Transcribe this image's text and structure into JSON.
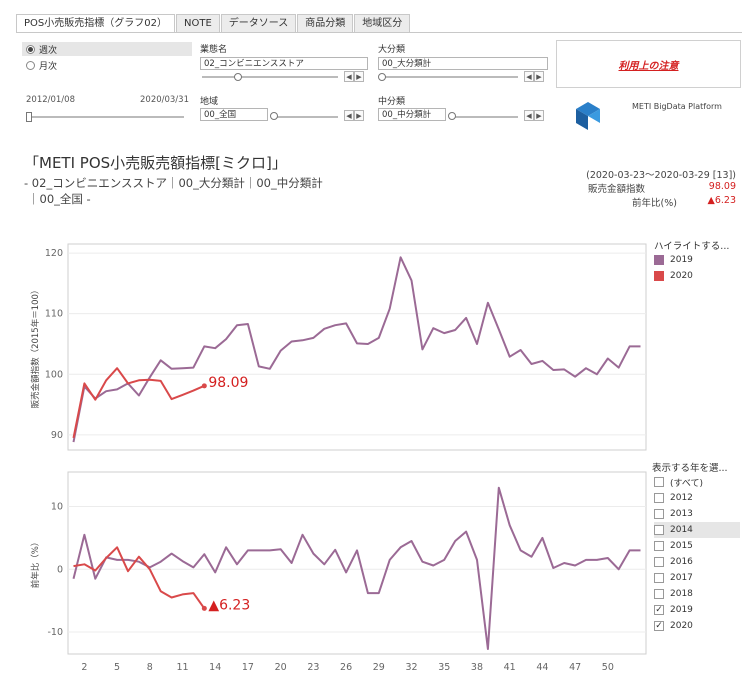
{
  "tabs": [
    "POS小売販売指標（グラフ02）",
    "NOTE",
    "データソース",
    "商品分類",
    "地域区分"
  ],
  "period": {
    "options": [
      "週次",
      "月次"
    ],
    "selected": "週次"
  },
  "date_range": {
    "start": "2012/01/08",
    "end": "2020/03/31"
  },
  "filters": {
    "gyotai": {
      "label": "業態名",
      "value": "02_コンビニエンスストア"
    },
    "daibunrui": {
      "label": "大分類",
      "value": "00_大分類計"
    },
    "chiiki": {
      "label": "地域",
      "value": "00_全国"
    },
    "chubunrui": {
      "label": "中分類",
      "value": "00_中分類計"
    }
  },
  "notice_label": "利用上の注意",
  "logo_text": "METI BigData Platform",
  "title": {
    "main": "「METI POS小売販売額指標[ミクロ]」",
    "sub1": "- 02_コンビニエンスストア｜00_大分類計｜00_中分類計",
    "sub2": "｜00_全国 -"
  },
  "summary": {
    "period": "(2020-03-23〜2020-03-29 [13])",
    "index_label": "販売金額指数",
    "index_value": "98.09",
    "yoy_label": "前年比(%)",
    "yoy_value": "▲6.23"
  },
  "legend_highlight": {
    "title": "ハイライトする...",
    "items": [
      {
        "label": "2019",
        "color": "#9b6a95"
      },
      {
        "label": "2020",
        "color": "#d9494a"
      }
    ]
  },
  "legend_years": {
    "title": "表示する年を選...",
    "items": [
      {
        "label": "(すべて)",
        "checked": false
      },
      {
        "label": "2012",
        "checked": false
      },
      {
        "label": "2013",
        "checked": false
      },
      {
        "label": "2014",
        "checked": false
      },
      {
        "label": "2015",
        "checked": false
      },
      {
        "label": "2016",
        "checked": false
      },
      {
        "label": "2017",
        "checked": false
      },
      {
        "label": "2018",
        "checked": false
      },
      {
        "label": "2019",
        "checked": true
      },
      {
        "label": "2020",
        "checked": true
      }
    ]
  },
  "chart_data": [
    {
      "type": "line",
      "ylabel": "販売金額指数（2015年＝100）",
      "ylim": [
        87.5,
        121.5
      ],
      "yticks": [
        90,
        100,
        110,
        120
      ],
      "xlim": [
        0.5,
        53.5
      ],
      "xticks": [
        2,
        5,
        8,
        11,
        14,
        17,
        20,
        23,
        26,
        29,
        32,
        35,
        38,
        41,
        44,
        47,
        50
      ],
      "series": [
        {
          "name": "2019",
          "color": "#9b6a95",
          "x": [
            1,
            2,
            3,
            4,
            5,
            6,
            7,
            8,
            9,
            10,
            11,
            12,
            13,
            14,
            15,
            16,
            17,
            18,
            19,
            20,
            21,
            22,
            23,
            24,
            25,
            26,
            27,
            28,
            29,
            30,
            31,
            32,
            33,
            34,
            35,
            36,
            37,
            38,
            39,
            40,
            41,
            42,
            43,
            44,
            45,
            46,
            47,
            48,
            49,
            50,
            51,
            52,
            53
          ],
          "values": [
            88.8,
            98.0,
            96.0,
            97.2,
            97.5,
            98.5,
            96.5,
            99.5,
            102.3,
            100.9,
            101.0,
            101.1,
            104.6,
            104.3,
            105.8,
            108.1,
            108.3,
            101.3,
            100.9,
            103.9,
            105.4,
            105.6,
            106.0,
            107.5,
            108.1,
            108.4,
            105.1,
            105.0,
            106.0,
            110.8,
            119.3,
            115.5,
            104.1,
            107.6,
            106.8,
            107.3,
            109.3,
            105.0,
            111.8,
            107.4,
            102.9,
            104.0,
            101.7,
            102.2,
            100.7,
            100.8,
            99.6,
            101.0,
            100.0,
            102.6,
            101.1,
            104.6,
            104.6
          ]
        },
        {
          "name": "2020",
          "color": "#d9494a",
          "x": [
            1,
            2,
            3,
            4,
            5,
            6,
            7,
            8,
            9,
            10,
            11,
            12,
            13
          ],
          "values": [
            89.5,
            98.5,
            95.8,
            99.0,
            101.0,
            98.5,
            99.0,
            99.1,
            98.9,
            95.9,
            96.6,
            97.3,
            98.09
          ]
        }
      ],
      "end_label": "98.09"
    },
    {
      "type": "line",
      "ylabel": "前年比（%）",
      "ylim": [
        -13.5,
        15.5
      ],
      "yticks": [
        -10,
        0,
        10
      ],
      "xlim": [
        0.5,
        53.5
      ],
      "xticks": [
        2,
        5,
        8,
        11,
        14,
        17,
        20,
        23,
        26,
        29,
        32,
        35,
        38,
        41,
        44,
        47,
        50
      ],
      "series": [
        {
          "name": "2019",
          "color": "#9b6a95",
          "x": [
            1,
            2,
            3,
            4,
            5,
            6,
            7,
            8,
            9,
            10,
            11,
            12,
            13,
            14,
            15,
            16,
            17,
            18,
            19,
            20,
            21,
            22,
            23,
            24,
            25,
            26,
            27,
            28,
            29,
            30,
            31,
            32,
            33,
            34,
            35,
            36,
            37,
            38,
            39,
            40,
            41,
            42,
            43,
            44,
            45,
            46,
            47,
            48,
            49,
            50,
            51,
            52,
            53
          ],
          "values": [
            -1.5,
            5.5,
            -1.5,
            1.9,
            1.5,
            1.5,
            1.2,
            0.3,
            1.2,
            2.5,
            1.3,
            0.3,
            2.4,
            -0.5,
            3.5,
            0.8,
            3.0,
            3.0,
            3.0,
            3.2,
            1.0,
            5.5,
            2.5,
            0.8,
            3.1,
            -0.5,
            3.0,
            -3.8,
            -3.8,
            1.5,
            3.5,
            4.5,
            1.2,
            0.6,
            1.5,
            4.5,
            6.0,
            1.5,
            -12.7,
            13.0,
            7.0,
            3.0,
            2.0,
            5.0,
            0.2,
            1.0,
            0.6,
            1.5,
            1.5,
            1.8,
            0.0,
            3.0,
            3.0
          ]
        },
        {
          "name": "2020",
          "color": "#d9494a",
          "x": [
            1,
            2,
            3,
            4,
            5,
            6,
            7,
            8,
            9,
            10,
            11,
            12,
            13
          ],
          "values": [
            0.5,
            0.8,
            -0.2,
            1.8,
            3.5,
            -0.3,
            2.0,
            0.0,
            -3.5,
            -4.5,
            -4.0,
            -3.8,
            -6.23
          ]
        }
      ],
      "end_label": "▲6.23"
    }
  ]
}
